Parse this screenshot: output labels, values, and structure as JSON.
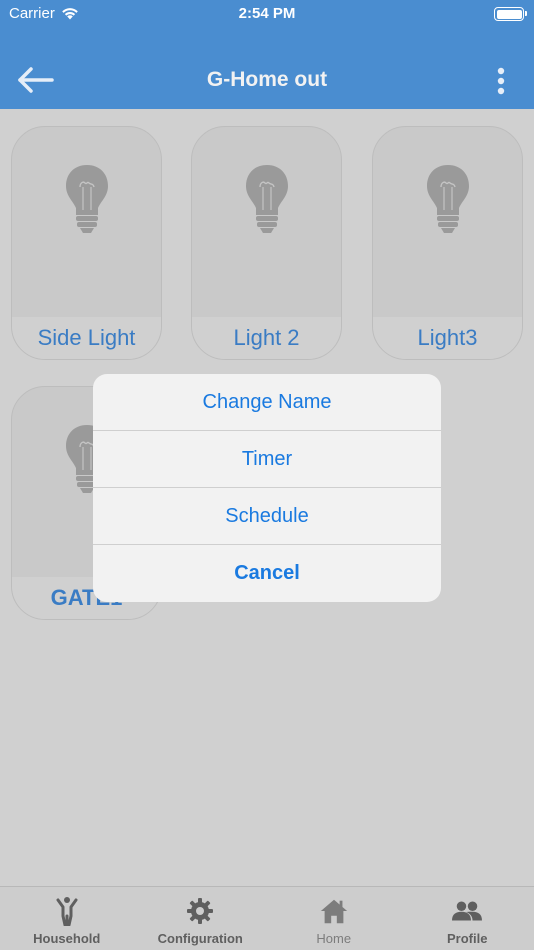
{
  "status_bar": {
    "carrier": "Carrier",
    "time": "2:54 PM"
  },
  "header": {
    "title": "G-Home out",
    "back_icon": "back-arrow-icon",
    "menu_icon": "more-vertical-icon"
  },
  "devices": [
    {
      "name": "Side Light",
      "icon": "light-bulb-icon"
    },
    {
      "name": "Light 2",
      "icon": "light-bulb-icon"
    },
    {
      "name": "Light3",
      "icon": "light-bulb-icon"
    },
    {
      "name": "GATE1",
      "icon": "light-bulb-icon"
    }
  ],
  "action_sheet": {
    "items": [
      "Change Name",
      "Timer",
      "Schedule"
    ],
    "cancel": "Cancel"
  },
  "tabs": [
    {
      "label": "Household",
      "icon": "person-icon"
    },
    {
      "label": "Configuration",
      "icon": "gear-icon"
    },
    {
      "label": "Home",
      "icon": "home-icon",
      "active": true
    },
    {
      "label": "Profile",
      "icon": "people-icon"
    }
  ],
  "colors": {
    "header": "#4a8dd0",
    "accent": "#1a7ae0",
    "device_label": "#3a7cc4",
    "overlay_bg": "#d0d0d0"
  }
}
